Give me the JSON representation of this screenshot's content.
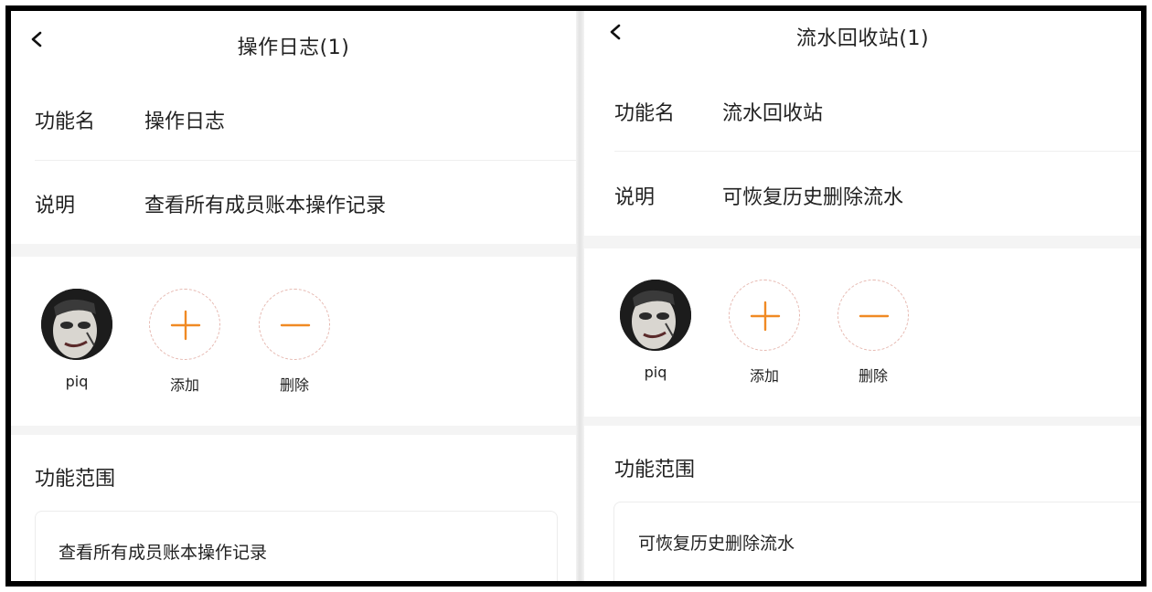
{
  "left": {
    "nav": {
      "title": "操作日志(1)"
    },
    "function_name": {
      "label": "功能名",
      "value": "操作日志"
    },
    "description": {
      "label": "说明",
      "value": "查看所有成员账本操作记录"
    },
    "members": {
      "user_name": "piq",
      "add_label": "添加",
      "remove_label": "删除"
    },
    "scope": {
      "title": "功能范围",
      "text": "查看所有成员账本操作记录"
    }
  },
  "right": {
    "nav": {
      "title": "流水回收站(1)"
    },
    "function_name": {
      "label": "功能名",
      "value": "流水回收站"
    },
    "description": {
      "label": "说明",
      "value": "可恢复历史删除流水"
    },
    "members": {
      "user_name": "piq",
      "add_label": "添加",
      "remove_label": "删除"
    },
    "scope": {
      "title": "功能范围",
      "text": "可恢复历史删除流水"
    }
  },
  "colors": {
    "accent": "#f08a24",
    "dashed_border": "#e6b8b0",
    "section_bg": "#f4f4f4",
    "frame": "#000000"
  },
  "icons": {
    "back": "chevron-left-icon",
    "add": "plus-icon",
    "remove": "minus-icon"
  }
}
